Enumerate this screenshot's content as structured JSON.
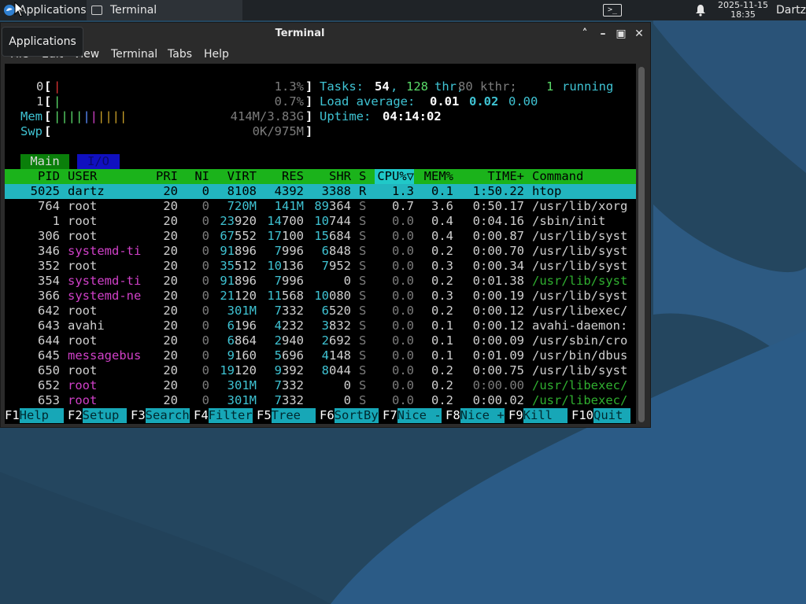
{
  "panel": {
    "apps_label": "Applications",
    "task_label": "Terminal",
    "term_applet_glyph": ">_",
    "clock_date": "2025-11-15",
    "clock_time": "18:35",
    "user": "Dartz"
  },
  "tooltip": "Applications",
  "window": {
    "title": "Terminal",
    "menu": [
      "File",
      "Edit",
      "View",
      "Terminal",
      "Tabs",
      "Help"
    ]
  },
  "htop": {
    "cpu0_label": "0",
    "cpu0_pct": "1.3%",
    "cpu1_label": "1",
    "cpu1_pct": "0.7%",
    "mem_label": "Mem",
    "mem_value": "414M/3.83G",
    "swp_label": "Swp",
    "swp_value": "0K/975M",
    "tasks_label": "Tasks:",
    "tasks_count": "54",
    "thr_count": "128",
    "thr_label": "thr,",
    "kthr": "80 kthr;",
    "running_count": "1",
    "running_label": "running",
    "load_label": "Load average:",
    "load1": "0.01",
    "load5": "0.02",
    "load15": "0.00",
    "uptime_label": "Uptime:",
    "uptime": "04:14:02",
    "tab_main": "Main",
    "tab_io": "I/O",
    "columns": [
      "PID",
      "USER",
      "PRI",
      "NI",
      "VIRT",
      "RES",
      "SHR",
      "S",
      "CPU%",
      "MEM%",
      "TIME+",
      "Command"
    ],
    "sort_marker": "▽",
    "processes": [
      {
        "pid": "5025",
        "user": "dartz",
        "pri": "20",
        "ni": "0",
        "virt": "8108",
        "res": "4392",
        "shr": "3388",
        "s": "R",
        "cpu": "1.3",
        "mem": "0.1",
        "time": "1:50.22",
        "cmd": "htop"
      },
      {
        "pid": "764",
        "user": "root",
        "pri": "20",
        "ni": "0",
        "virt": "720M",
        "res": "141M",
        "shr": "89364",
        "s": "S",
        "cpu": "0.7",
        "mem": "3.6",
        "time": "0:50.17",
        "cmd": "/usr/lib/xorg"
      },
      {
        "pid": "1",
        "user": "root",
        "pri": "20",
        "ni": "0",
        "virt": "23920",
        "res": "14700",
        "shr": "10744",
        "s": "S",
        "cpu": "0.0",
        "mem": "0.4",
        "time": "0:04.16",
        "cmd": "/sbin/init"
      },
      {
        "pid": "306",
        "user": "root",
        "pri": "20",
        "ni": "0",
        "virt": "67552",
        "res": "17100",
        "shr": "15684",
        "s": "S",
        "cpu": "0.0",
        "mem": "0.4",
        "time": "0:00.87",
        "cmd": "/usr/lib/syst"
      },
      {
        "pid": "346",
        "user": "systemd-ti",
        "pri": "20",
        "ni": "0",
        "virt": "91896",
        "res": "7996",
        "shr": "6848",
        "s": "S",
        "cpu": "0.0",
        "mem": "0.2",
        "time": "0:00.70",
        "cmd": "/usr/lib/syst"
      },
      {
        "pid": "352",
        "user": "root",
        "pri": "20",
        "ni": "0",
        "virt": "35512",
        "res": "10136",
        "shr": "7952",
        "s": "S",
        "cpu": "0.0",
        "mem": "0.3",
        "time": "0:00.34",
        "cmd": "/usr/lib/syst"
      },
      {
        "pid": "354",
        "user": "systemd-ti",
        "pri": "20",
        "ni": "0",
        "virt": "91896",
        "res": "7996",
        "shr": "0",
        "s": "S",
        "cpu": "0.0",
        "mem": "0.2",
        "time": "0:01.38",
        "cmd": "/usr/lib/syst"
      },
      {
        "pid": "366",
        "user": "systemd-ne",
        "pri": "20",
        "ni": "0",
        "virt": "21120",
        "res": "11568",
        "shr": "10080",
        "s": "S",
        "cpu": "0.0",
        "mem": "0.3",
        "time": "0:00.19",
        "cmd": "/usr/lib/syst"
      },
      {
        "pid": "642",
        "user": "root",
        "pri": "20",
        "ni": "0",
        "virt": "301M",
        "res": "7332",
        "shr": "6520",
        "s": "S",
        "cpu": "0.0",
        "mem": "0.2",
        "time": "0:00.12",
        "cmd": "/usr/libexec/"
      },
      {
        "pid": "643",
        "user": "avahi",
        "pri": "20",
        "ni": "0",
        "virt": "6196",
        "res": "4232",
        "shr": "3832",
        "s": "S",
        "cpu": "0.0",
        "mem": "0.1",
        "time": "0:00.12",
        "cmd": "avahi-daemon:"
      },
      {
        "pid": "644",
        "user": "root",
        "pri": "20",
        "ni": "0",
        "virt": "6864",
        "res": "2940",
        "shr": "2692",
        "s": "S",
        "cpu": "0.0",
        "mem": "0.1",
        "time": "0:00.09",
        "cmd": "/usr/sbin/cro"
      },
      {
        "pid": "645",
        "user": "messagebus",
        "pri": "20",
        "ni": "0",
        "virt": "9160",
        "res": "5696",
        "shr": "4148",
        "s": "S",
        "cpu": "0.0",
        "mem": "0.1",
        "time": "0:01.09",
        "cmd": "/usr/bin/dbus"
      },
      {
        "pid": "650",
        "user": "root",
        "pri": "20",
        "ni": "0",
        "virt": "19120",
        "res": "9392",
        "shr": "8044",
        "s": "S",
        "cpu": "0.0",
        "mem": "0.2",
        "time": "0:00.75",
        "cmd": "/usr/lib/syst"
      },
      {
        "pid": "652",
        "user": "root",
        "pri": "20",
        "ni": "0",
        "virt": "301M",
        "res": "7332",
        "shr": "0",
        "s": "S",
        "cpu": "0.0",
        "mem": "0.2",
        "time": "0:00.00",
        "cmd": "/usr/libexec/"
      },
      {
        "pid": "653",
        "user": "root",
        "pri": "20",
        "ni": "0",
        "virt": "301M",
        "res": "7332",
        "shr": "0",
        "s": "S",
        "cpu": "0.0",
        "mem": "0.2",
        "time": "0:00.02",
        "cmd": "/usr/libexec/"
      }
    ],
    "fkeys": [
      {
        "key": "F1",
        "label": "Help  "
      },
      {
        "key": "F2",
        "label": "Setup "
      },
      {
        "key": "F3",
        "label": "Search"
      },
      {
        "key": "F4",
        "label": "Filter"
      },
      {
        "key": "F5",
        "label": "Tree  "
      },
      {
        "key": "F6",
        "label": "SortBy"
      },
      {
        "key": "F7",
        "label": "Nice -"
      },
      {
        "key": "F8",
        "label": "Nice +"
      },
      {
        "key": "F9",
        "label": "Kill  "
      },
      {
        "key": "F10",
        "label": "Quit "
      }
    ]
  },
  "colors": {
    "header_green": "#1bb31b",
    "selection_cyan": "#22b5bf",
    "fkey_bg": "#17a7b7",
    "user_magenta": "#d040c8",
    "cmd_green": "#30b030"
  }
}
